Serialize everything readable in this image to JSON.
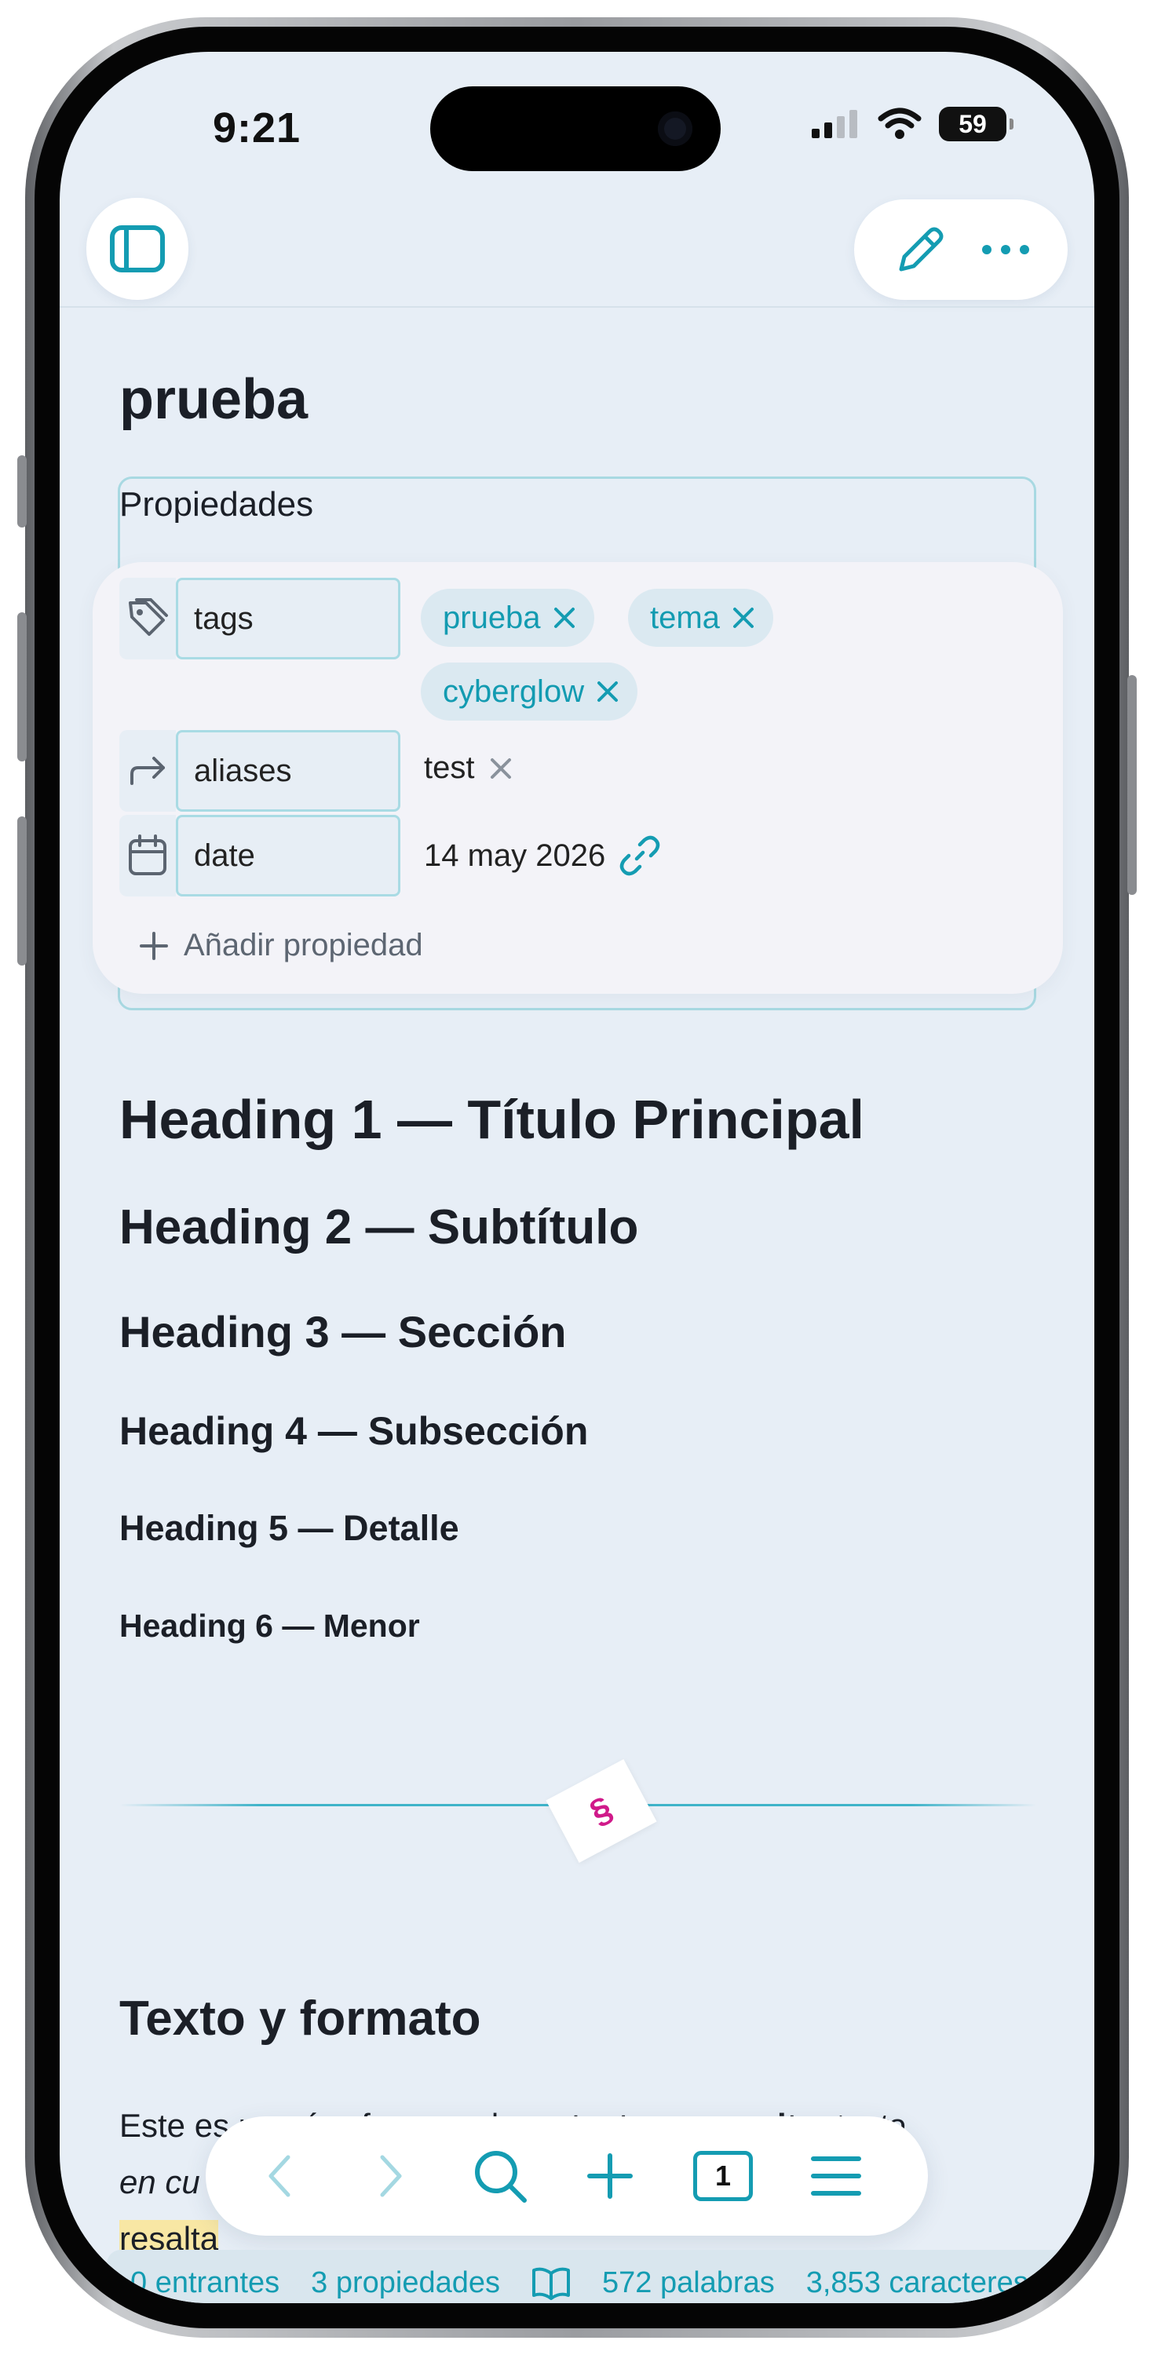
{
  "status": {
    "time": "9:21",
    "battery": "59"
  },
  "note": {
    "title": "prueba"
  },
  "properties": {
    "label": "Propiedades",
    "tags_key": "tags",
    "tags": [
      "prueba",
      "tema",
      "cyberglow"
    ],
    "aliases_key": "aliases",
    "aliases_value": "test",
    "date_key": "date",
    "date_value": "14 may 2026",
    "add_label": "Añadir propiedad"
  },
  "headings": {
    "h1": "Heading 1 — Título Principal",
    "h2": "Heading 2 — Subtítulo",
    "h3": "Heading 3 — Sección",
    "h4": "Heading 4 — Subsección",
    "h5": "Heading 5 — Detalle",
    "h6": "Heading 6 — Menor"
  },
  "section_heading": "Texto y formato",
  "paragraph": {
    "p1": "Este es un párrafo normal con ",
    "bold": "texto en negrita",
    "p2": ", ",
    "italic_a": "texto",
    "italic_b": "en cu",
    "hl_a": "xto",
    "hl_b": "resalta"
  },
  "footer": {
    "incoming": "0 entrantes",
    "properties": "3 propiedades",
    "words": "572 palabras",
    "chars": "3,853 caracteres"
  },
  "toolbar": {
    "tabs_count": "1"
  },
  "colors": {
    "accent": "#18a0ba",
    "background": "#e7eef6",
    "highlight": "#f8e7a4"
  }
}
